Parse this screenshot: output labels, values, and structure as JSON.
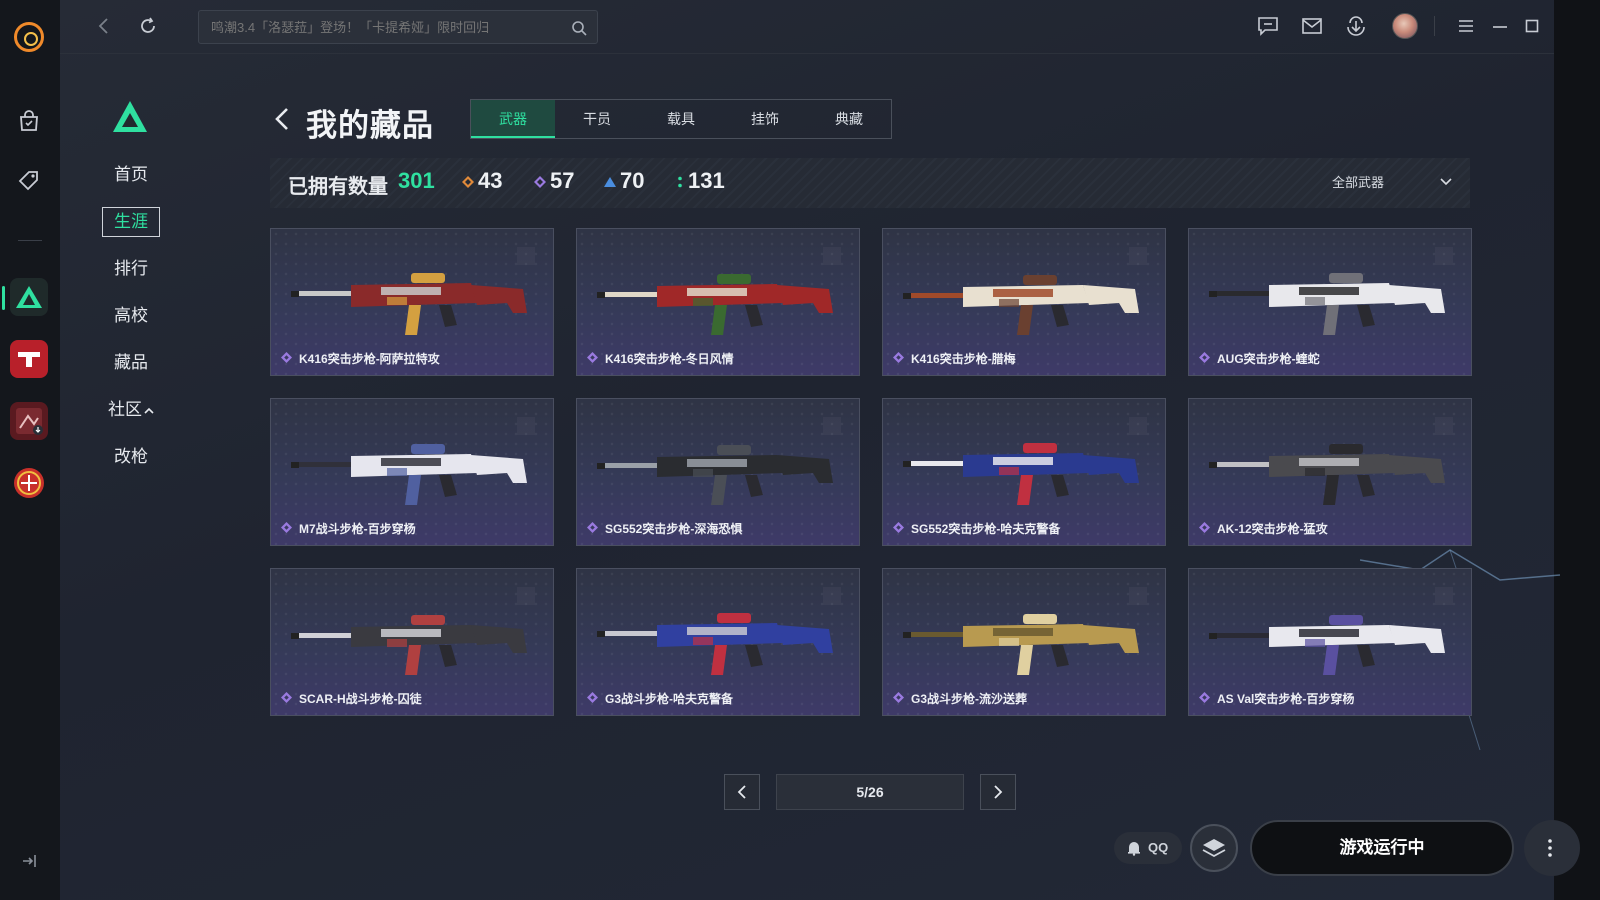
{
  "topbar": {
    "search_placeholder": "鸣潮3.4「洛瑟菈」登场！「卡提希娅」限时回归"
  },
  "nav": {
    "items": [
      "首页",
      "生涯",
      "排行",
      "高校",
      "藏品",
      "社区",
      "改枪"
    ],
    "active_index": 1
  },
  "header": {
    "title": "我的藏品",
    "tabs": [
      "武器",
      "干员",
      "载具",
      "挂饰",
      "典藏"
    ],
    "active_tab": 0
  },
  "stats": {
    "owned_label": "已拥有数量",
    "owned_total": "301",
    "tiers": [
      {
        "count": "43",
        "color": "#e08a3a",
        "icon": "diamond-orange-icon"
      },
      {
        "count": "57",
        "color": "#9a7ae0",
        "icon": "diamond-purple-icon"
      },
      {
        "count": "70",
        "color": "#4a8ee0",
        "icon": "triangle-blue-icon"
      },
      {
        "count": "131",
        "color": "#2fe0a0",
        "icon": "dots-green-icon"
      }
    ],
    "filter_label": "全部武器"
  },
  "items": [
    {
      "name": "K416突击步枪-阿萨拉特攻",
      "palette": [
        "#8a2a2a",
        "#c8c8c8",
        "#d4a040"
      ]
    },
    {
      "name": "K416突击步枪-冬日风情",
      "palette": [
        "#a02828",
        "#e0d8c8",
        "#3a6a30"
      ]
    },
    {
      "name": "K416突击步枪-腊梅",
      "palette": [
        "#e8e0d0",
        "#a04a2a",
        "#6a4030"
      ]
    },
    {
      "name": "AUG突击步枪-蝰蛇",
      "palette": [
        "#e8e8ec",
        "#2a2a2e",
        "#707078"
      ]
    },
    {
      "name": "M7战斗步枪-百步穿杨",
      "palette": [
        "#e6e6ee",
        "#30303a",
        "#5060a0"
      ]
    },
    {
      "name": "SG552突击步枪-深海恐惧",
      "palette": [
        "#2a2c30",
        "#9aa0a8",
        "#4a4e56"
      ]
    },
    {
      "name": "SG552突击步枪-哈夫克警备",
      "palette": [
        "#2a3a90",
        "#e8e8ee",
        "#c03040"
      ]
    },
    {
      "name": "AK-12突击步枪-猛攻",
      "palette": [
        "#4a4a4e",
        "#c0c0c4",
        "#2a2a2e"
      ]
    },
    {
      "name": "SCAR-H战斗步枪-囚徒",
      "palette": [
        "#3a3a40",
        "#d0d0d6",
        "#b04040"
      ]
    },
    {
      "name": "G3战斗步枪-哈夫克警备",
      "palette": [
        "#3040a0",
        "#c8c8d0",
        "#c03040"
      ]
    },
    {
      "name": "G3战斗步枪-流沙送葬",
      "palette": [
        "#b89a50",
        "#6a5a30",
        "#e0d0a0"
      ]
    },
    {
      "name": "AS Val突击步枪-百步穿杨",
      "palette": [
        "#e8e8ee",
        "#2a2a34",
        "#5a50a0"
      ]
    }
  ],
  "pagination": {
    "current": "5/26"
  },
  "bottom": {
    "qq_label": "QQ",
    "run_label": "游戏运行中"
  },
  "colors": {
    "accent": "#2fe0a0",
    "rarity": "#9a7ae0"
  }
}
